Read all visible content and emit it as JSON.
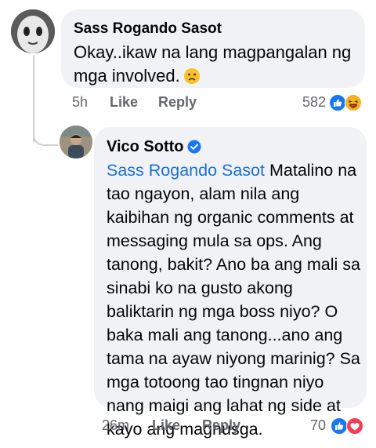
{
  "comment": {
    "author": "Sass Rogando Sasot",
    "text": "Okay..ikaw na lang magpangalan ng mga involved.",
    "emoji": "frowning-face",
    "time": "5h",
    "like_label": "Like",
    "reply_label": "Reply",
    "reaction_count": "582",
    "reactions": [
      "like",
      "haha"
    ]
  },
  "reply": {
    "author": "Vico Sotto",
    "verified": true,
    "mention": "Sass Rogando Sasot",
    "text": "Matalino na tao ngayon, alam nila ang kaibihan ng organic comments at messaging mula sa ops. Ang tanong, bakit? Ano ba ang mali sa sinabi ko na gusto akong baliktarin ng mga boss niyo? O baka mali ang tanong...ano ang tama na ayaw niyong marinig? Sa mga totoong tao tingnan niyo nang maigi ang lahat ng side at kayo ang maghusga.",
    "time": "26m",
    "like_label": "Like",
    "reply_label": "Reply",
    "reaction_count": "70",
    "reactions": [
      "like",
      "love"
    ]
  },
  "colors": {
    "bubble": "#f0f2f5",
    "mention": "#1b6fd6",
    "meta": "#65676b",
    "like": "#1877f2",
    "love": "#f33e58",
    "haha": "#f7b125"
  }
}
